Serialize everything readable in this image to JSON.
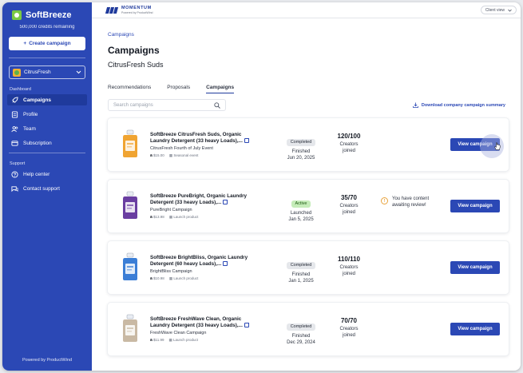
{
  "sidebar": {
    "brand_name": "SoftBreeze",
    "credits": "500,000 credits remaining",
    "create_label": "Create campaign",
    "selected_brand": "CitrusFresh",
    "section_dashboard": "Dashboard",
    "nav": [
      {
        "label": "Campaigns",
        "icon": "rocket-icon",
        "active": true
      },
      {
        "label": "Profile",
        "icon": "profile-icon"
      },
      {
        "label": "Team",
        "icon": "team-icon"
      },
      {
        "label": "Subscription",
        "icon": "card-icon"
      }
    ],
    "section_support": "Support",
    "support": [
      {
        "label": "Help center",
        "icon": "help-icon"
      },
      {
        "label": "Contact support",
        "icon": "chat-icon"
      }
    ],
    "powered_by": "Powered by ProductWind"
  },
  "topbar": {
    "logo_name": "MOMENTUM",
    "logo_sub": "Powered by ProductWind",
    "client_view": "Client view"
  },
  "breadcrumb": "Campaigns",
  "page_title": "Campaigns",
  "brand_title": "CitrusFresh Suds",
  "tabs": [
    "Recommendations",
    "Proposals",
    "Campaigns"
  ],
  "search_placeholder": "Search campaigns",
  "download_label": "Download company campaign summary",
  "view_label": "View campaign",
  "campaigns": [
    {
      "name": "SoftBreeze CitrusFresh Suds, Organic Laundry Detergent (33 heavy Loads),...",
      "campaign": "CitrusFresh Fourth of July Event",
      "price": "$15.00",
      "type": "Seasonal event",
      "status": "Completed",
      "status_text": "Finished",
      "date": "Jun 20, 2025",
      "creators": "120/100",
      "creators_label": "Creators joined",
      "bottle_color": "#f0a432"
    },
    {
      "name": "SoftBreeze PureBright, Organic Laundry Detergent (33 heavy Loads),...",
      "campaign": "PureBright Campaign",
      "price": "$13.98",
      "type": "Launch product",
      "status": "Active",
      "status_text": "Launched",
      "date": "Jan 5, 2025",
      "creators": "35/70",
      "creators_label": "Creators joined",
      "note": "You have content awaiting review!",
      "bottle_color": "#6a3ea1"
    },
    {
      "name": "SoftBreeze BrightBliss, Organic Laundry Detergent (60 heavy Loads),...",
      "campaign": "BrightBliss Campaign",
      "price": "$10.98",
      "type": "Launch product",
      "status": "Completed",
      "status_text": "Finished",
      "date": "Jan 1, 2025",
      "creators": "110/110",
      "creators_label": "Creators joined",
      "bottle_color": "#3b7ed6"
    },
    {
      "name": "SoftBreeze FreshWave Clean, Organic Laundry Detergent (33 heavy Loads),...",
      "campaign": "FreshWave Clean Campaign",
      "price": "$11.99",
      "type": "Launch product",
      "status": "Completed",
      "status_text": "Finished",
      "date": "Dec 29, 2024",
      "creators": "70/70",
      "creators_label": "Creators joined",
      "bottle_color": "#c9b9a4"
    }
  ]
}
